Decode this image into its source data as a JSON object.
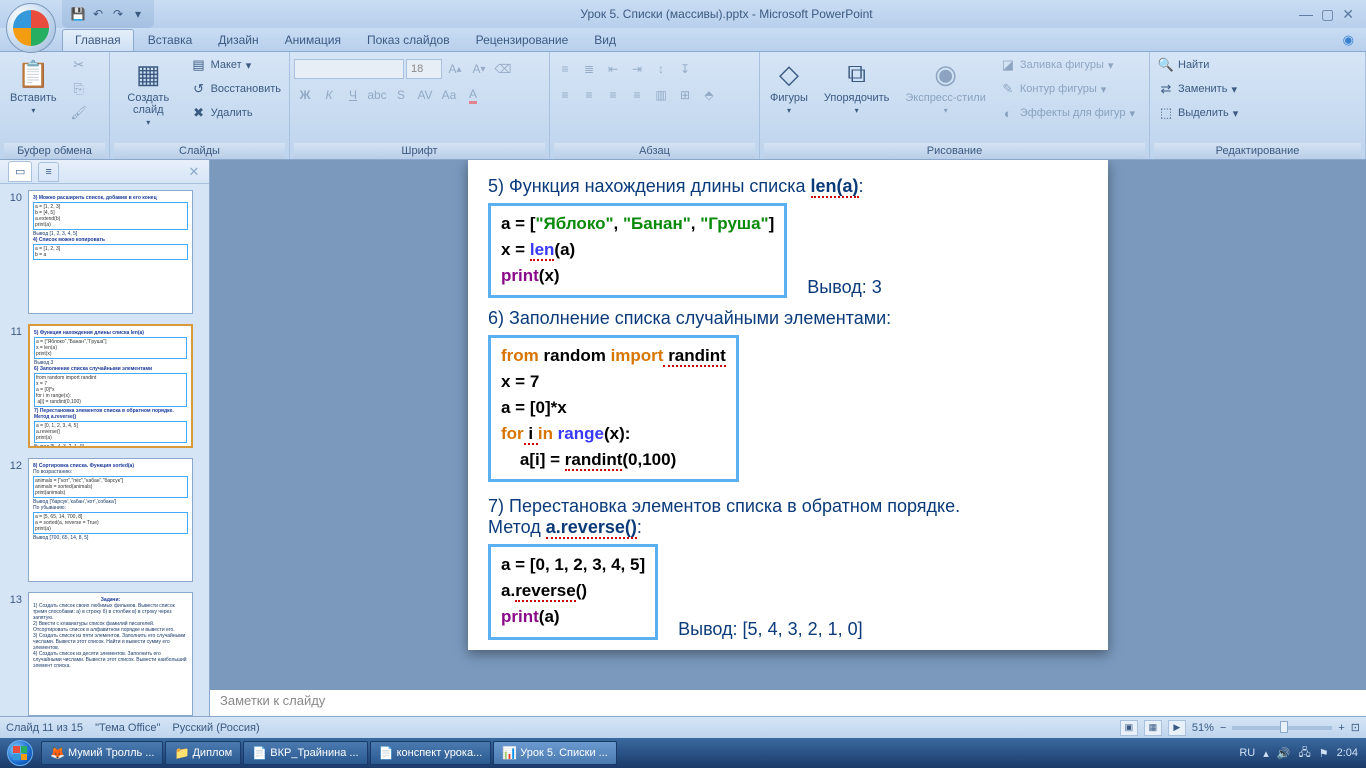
{
  "title": "Урок 5. Списки (массивы).pptx - Microsoft PowerPoint",
  "tabs": {
    "home": "Главная",
    "insert": "Вставка",
    "design": "Дизайн",
    "anim": "Анимация",
    "show": "Показ слайдов",
    "review": "Рецензирование",
    "view": "Вид"
  },
  "ribbon": {
    "clipboard": {
      "label": "Буфер обмена",
      "paste": "Вставить"
    },
    "slides": {
      "label": "Слайды",
      "new": "Создать слайд",
      "layout": "Макет",
      "reset": "Восстановить",
      "delete": "Удалить"
    },
    "font": {
      "label": "Шрифт",
      "size": "18"
    },
    "para": {
      "label": "Абзац"
    },
    "draw": {
      "label": "Рисование",
      "shapes": "Фигуры",
      "arrange": "Упорядочить",
      "styles": "Экспресс-стили",
      "fill": "Заливка фигуры",
      "outline": "Контур фигуры",
      "effects": "Эффекты для фигур"
    },
    "edit": {
      "label": "Редактирование",
      "find": "Найти",
      "replace": "Заменить",
      "select": "Выделить"
    }
  },
  "slide": {
    "h5": "5) Функция нахождения длины списка ",
    "h5b": "len(a)",
    "code5_l1a": "a = [",
    "code5_l1b": "\"Яблоко\"",
    "code5_l1c": ", ",
    "code5_l1d": "\"Банан\"",
    "code5_l1e": ", ",
    "code5_l1f": "\"Груша\"",
    "code5_l1g": "]",
    "code5_l2a": "x = ",
    "code5_l2b": "len",
    "code5_l2c": "(a)",
    "code5_l3a": "print",
    "code5_l3b": "(x)",
    "out5": "Вывод: 3",
    "h6": "6) Заполнение списка случайными элементами:",
    "code6_l1a": "from",
    "code6_l1b": " random ",
    "code6_l1c": "import",
    "code6_l1d": " randint",
    "code6_l2": "x = 7",
    "code6_l3": "a = [0]*x",
    "code6_l4a": "for",
    "code6_l4b": " i ",
    "code6_l4c": "in",
    "code6_l4d": " range",
    "code6_l4e": "(x):",
    "code6_l5a": "    a[i] = ",
    "code6_l5b": "randint",
    "code6_l5c": "(0,100)",
    "h7a": "7) Перестановка  элементов списка в обратном порядке.",
    "h7b": "Метод ",
    "h7c": "a.reverse()",
    "code7_l1": "a = [0, 1, 2, 3, 4, 5]",
    "code7_l2a": "a.",
    "code7_l2b": "reverse",
    "code7_l2c": "()",
    "code7_l3a": "print",
    "code7_l3b": "(a)",
    "out7": "Вывод: [5, 4, 3, 2, 1, 0]"
  },
  "notes": "Заметки к слайду",
  "status": {
    "slide": "Слайд 11 из 15",
    "theme": "\"Тема Office\"",
    "lang": "Русский (Россия)",
    "zoom": "51%"
  },
  "taskbar": {
    "t1": "Мумий Тролль ...",
    "t2": "Диплом",
    "t3": "ВКР_Трайнина ...",
    "t4": "конспект урока...",
    "t5": "Урок 5. Списки ...",
    "lang": "RU",
    "time": "2:04"
  },
  "thumbs": {
    "n10": "10",
    "n11": "11",
    "n12": "12",
    "n13": "13"
  }
}
